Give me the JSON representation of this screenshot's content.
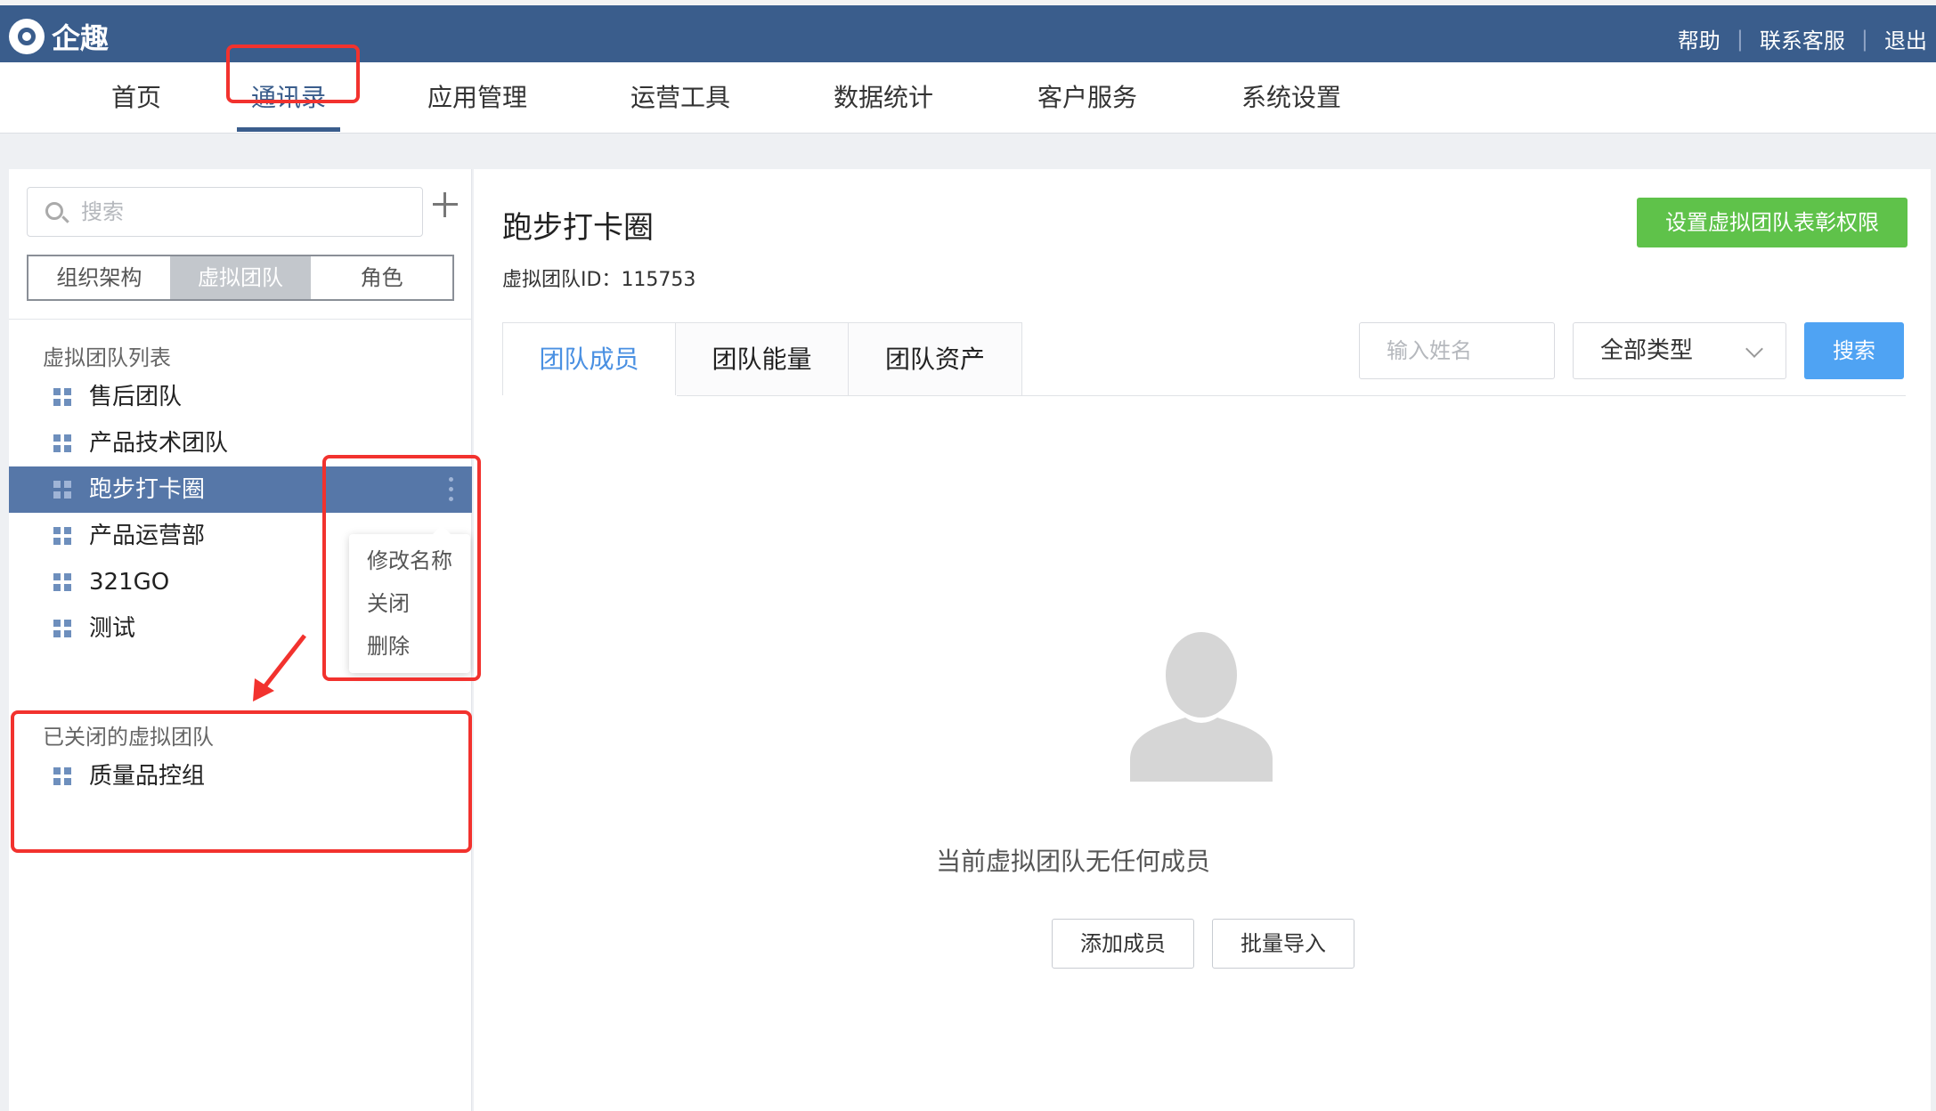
{
  "header": {
    "brand": "企趣",
    "links": [
      "帮助",
      "联系客服",
      "退出"
    ],
    "separator": "|"
  },
  "nav": {
    "items": [
      "首页",
      "通讯录",
      "应用管理",
      "运营工具",
      "数据统计",
      "客户服务",
      "系统设置"
    ],
    "active": "通讯录"
  },
  "sidebar": {
    "search_placeholder": "搜索",
    "segments": [
      "组织架构",
      "虚拟团队",
      "角色"
    ],
    "active_segment": "虚拟团队",
    "list_title": "虚拟团队列表",
    "teams": [
      "售后团队",
      "产品技术团队",
      "跑步打卡圈",
      "产品运营部",
      "321GO",
      "测试"
    ],
    "selected_team": "跑步打卡圈",
    "context_menu": [
      "修改名称",
      "关闭",
      "删除"
    ],
    "closed_title": "已关闭的虚拟团队",
    "closed_teams": [
      "质量品控组"
    ]
  },
  "main": {
    "title": "跑步打卡圈",
    "team_id_label": "虚拟团队ID：",
    "team_id": "115753",
    "permission_button": "设置虚拟团队表彰权限",
    "tabs": [
      "团队成员",
      "团队能量",
      "团队资产"
    ],
    "active_tab": "团队成员",
    "name_input_placeholder": "输入姓名",
    "type_select_value": "全部类型",
    "search_button": "搜索",
    "empty_text": "当前虚拟团队无任何成员",
    "add_member_button": "添加成员",
    "batch_import_button": "批量导入"
  },
  "colors": {
    "header_bg": "#3a5d8c",
    "selected_row": "#5677a8",
    "primary_green": "#5fc24a",
    "primary_blue": "#4fa3f3",
    "annotation_red": "#f2322e"
  }
}
